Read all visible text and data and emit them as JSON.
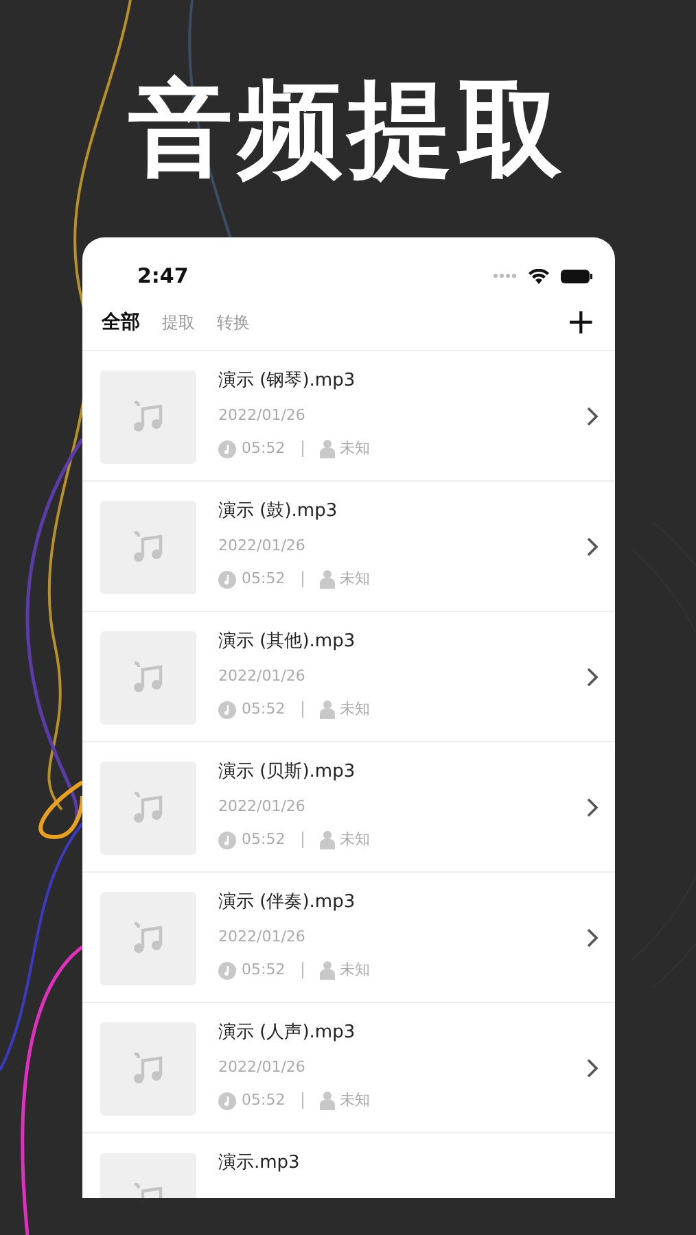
{
  "headline": "音频提取",
  "status_bar": {
    "time": "2:47"
  },
  "tabs": [
    {
      "label": "全部",
      "selected": true
    },
    {
      "label": "提取",
      "selected": false
    },
    {
      "label": "转换",
      "selected": false
    }
  ],
  "add_button": "+",
  "files": [
    {
      "name": "演示 (钢琴).mp3",
      "date": "2022/01/26",
      "duration": "05:52",
      "artist": "未知"
    },
    {
      "name": "演示 (鼓).mp3",
      "date": "2022/01/26",
      "duration": "05:52",
      "artist": "未知"
    },
    {
      "name": "演示 (其他).mp3",
      "date": "2022/01/26",
      "duration": "05:52",
      "artist": "未知"
    },
    {
      "name": "演示 (贝斯).mp3",
      "date": "2022/01/26",
      "duration": "05:52",
      "artist": "未知"
    },
    {
      "name": "演示 (伴奏).mp3",
      "date": "2022/01/26",
      "duration": "05:52",
      "artist": "未知"
    },
    {
      "name": "演示 (人声).mp3",
      "date": "2022/01/26",
      "duration": "05:52",
      "artist": "未知"
    },
    {
      "name": "演示.mp3"
    }
  ]
}
